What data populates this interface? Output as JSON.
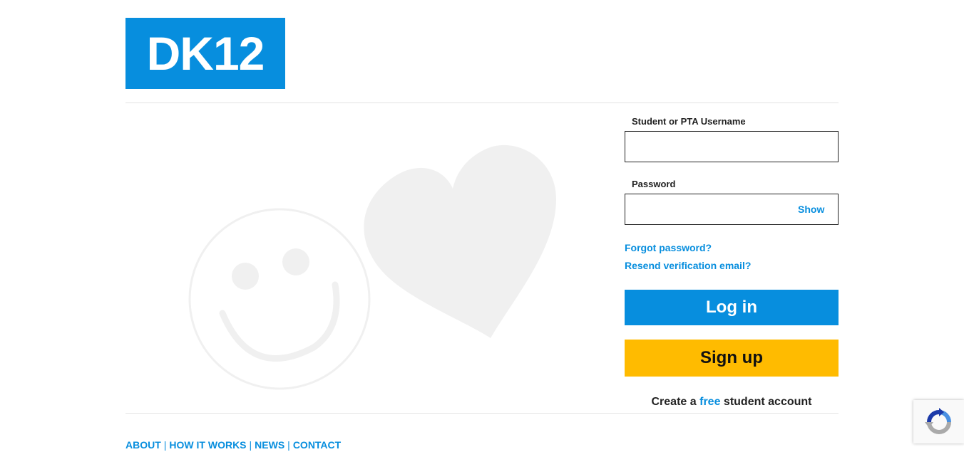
{
  "logo": {
    "text": "DK12"
  },
  "login_form": {
    "username_label": "Student or PTA Username",
    "username_value": "",
    "password_label": "Password",
    "password_value": "",
    "show_label": "Show",
    "forgot_password": "Forgot password?",
    "resend_verification": "Resend verification email?",
    "login_button": "Log in",
    "signup_button": "Sign up",
    "create_prefix": "Create a",
    "create_free": "free",
    "create_suffix": "student account"
  },
  "footer": {
    "links": [
      "ABOUT",
      "HOW IT WORKS",
      "NEWS",
      "CONTACT"
    ],
    "separator": "|"
  },
  "colors": {
    "brand_blue": "#078ede",
    "signup_yellow": "#ffbb00",
    "illustration_gray": "#f0f0f0"
  },
  "icons": {
    "hero": [
      "smiley-face-icon",
      "heart-icon"
    ],
    "badge": "recaptcha-icon"
  }
}
